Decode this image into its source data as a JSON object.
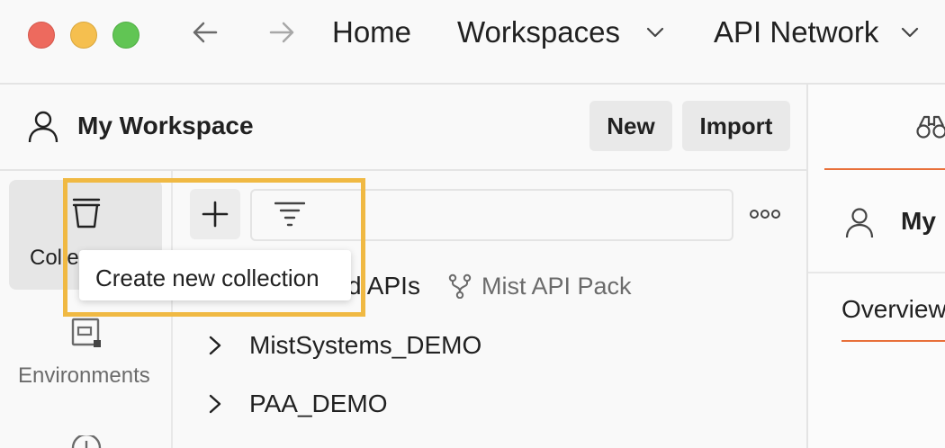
{
  "titlebar": {
    "nav_items": [
      {
        "label": "Home"
      },
      {
        "label": "Workspaces"
      },
      {
        "label": "API Network"
      }
    ]
  },
  "workspace": {
    "title": "My Workspace",
    "new_label": "New",
    "import_label": "Import"
  },
  "rail": {
    "collections_label": "Colle",
    "environments_label": "Environments"
  },
  "tooltip": {
    "text": "Create new collection"
  },
  "tree": {
    "items": [
      {
        "label": "d APIs",
        "fork_label": "Mist API Pack"
      },
      {
        "label": "MistSystems_DEMO"
      },
      {
        "label": "PAA_DEMO"
      }
    ]
  },
  "right_panel": {
    "user_label": "My",
    "tab_overview": "Overview"
  },
  "colors": {
    "highlight": "#f0b943",
    "accent": "#e8703a"
  }
}
